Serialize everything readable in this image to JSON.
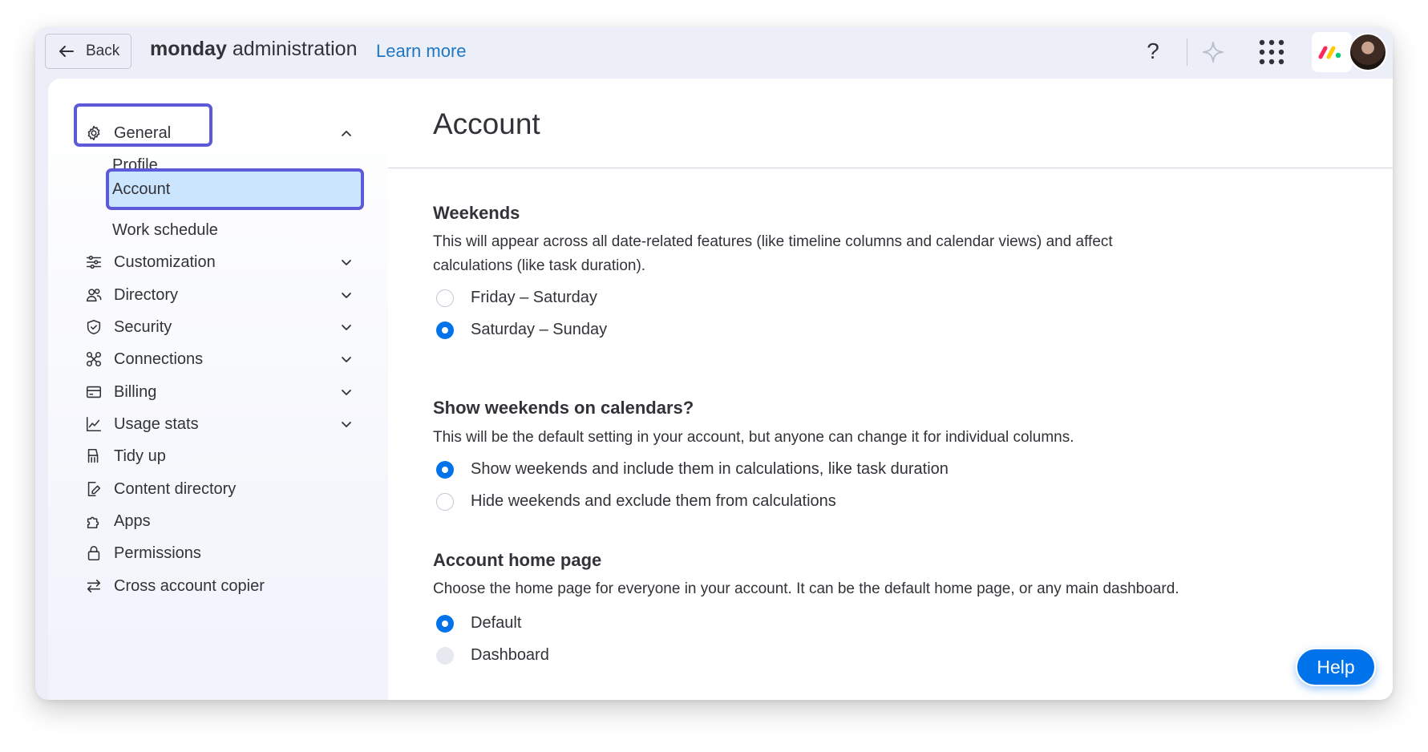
{
  "header": {
    "back_label": "Back",
    "brand_bold": "monday",
    "brand_rest": "administration",
    "learn_more": "Learn more",
    "help_glyph": "?",
    "icons": [
      "arrow-left-icon",
      "question-icon",
      "sparkle-icon",
      "apps-grid-icon",
      "monday-logo-icon",
      "avatar"
    ]
  },
  "sidebar": {
    "general": {
      "label": "General",
      "icon": "gear-icon",
      "expanded": true
    },
    "general_sub": [
      {
        "label": "Profile"
      },
      {
        "label": "Account",
        "selected": true
      },
      {
        "label": "Work schedule"
      }
    ],
    "items": [
      {
        "label": "Customization",
        "icon": "sliders-icon",
        "has_chevron": true
      },
      {
        "label": "Directory",
        "icon": "people-icon",
        "has_chevron": true
      },
      {
        "label": "Security",
        "icon": "shield-icon",
        "has_chevron": true
      },
      {
        "label": "Connections",
        "icon": "connections-icon",
        "has_chevron": true
      },
      {
        "label": "Billing",
        "icon": "card-icon",
        "has_chevron": true
      },
      {
        "label": "Usage stats",
        "icon": "chart-icon",
        "has_chevron": true
      },
      {
        "label": "Tidy up",
        "icon": "broom-icon",
        "has_chevron": false
      },
      {
        "label": "Content directory",
        "icon": "edit-doc-icon",
        "has_chevron": false
      },
      {
        "label": "Apps",
        "icon": "puzzle-icon",
        "has_chevron": false
      },
      {
        "label": "Permissions",
        "icon": "lock-icon",
        "has_chevron": false
      },
      {
        "label": "Cross account copier",
        "icon": "swap-icon",
        "has_chevron": false
      }
    ]
  },
  "main": {
    "title": "Account",
    "weekends": {
      "title": "Weekends",
      "desc_line1": "This will appear across all date-related features (like timeline columns and calendar views) and affect",
      "desc_line2": "calculations (like task duration).",
      "options": [
        {
          "label": "Friday – Saturday",
          "checked": false
        },
        {
          "label": "Saturday – Sunday",
          "checked": true
        }
      ]
    },
    "show_weekends": {
      "title": "Show weekends on calendars?",
      "desc": "This will be the default setting in your account, but anyone can change it for individual columns.",
      "options": [
        {
          "label": "Show weekends and include them in calculations, like task duration",
          "checked": true
        },
        {
          "label": "Hide weekends and exclude them from calculations",
          "checked": false
        }
      ]
    },
    "home_page": {
      "title": "Account home page",
      "desc": "Choose the home page for everyone in your account. It can be the default home page, or any main dashboard.",
      "options": [
        {
          "label": "Default",
          "checked": true
        },
        {
          "label": "Dashboard",
          "checked": false,
          "disabled": true
        }
      ]
    }
  },
  "help_button": {
    "label": "Help"
  },
  "colors": {
    "accent": "#0073ea",
    "highlight_outline": "#5c5ad6",
    "selected_bg": "#cce5ff",
    "link": "#1f76c2",
    "text": "#323338"
  }
}
